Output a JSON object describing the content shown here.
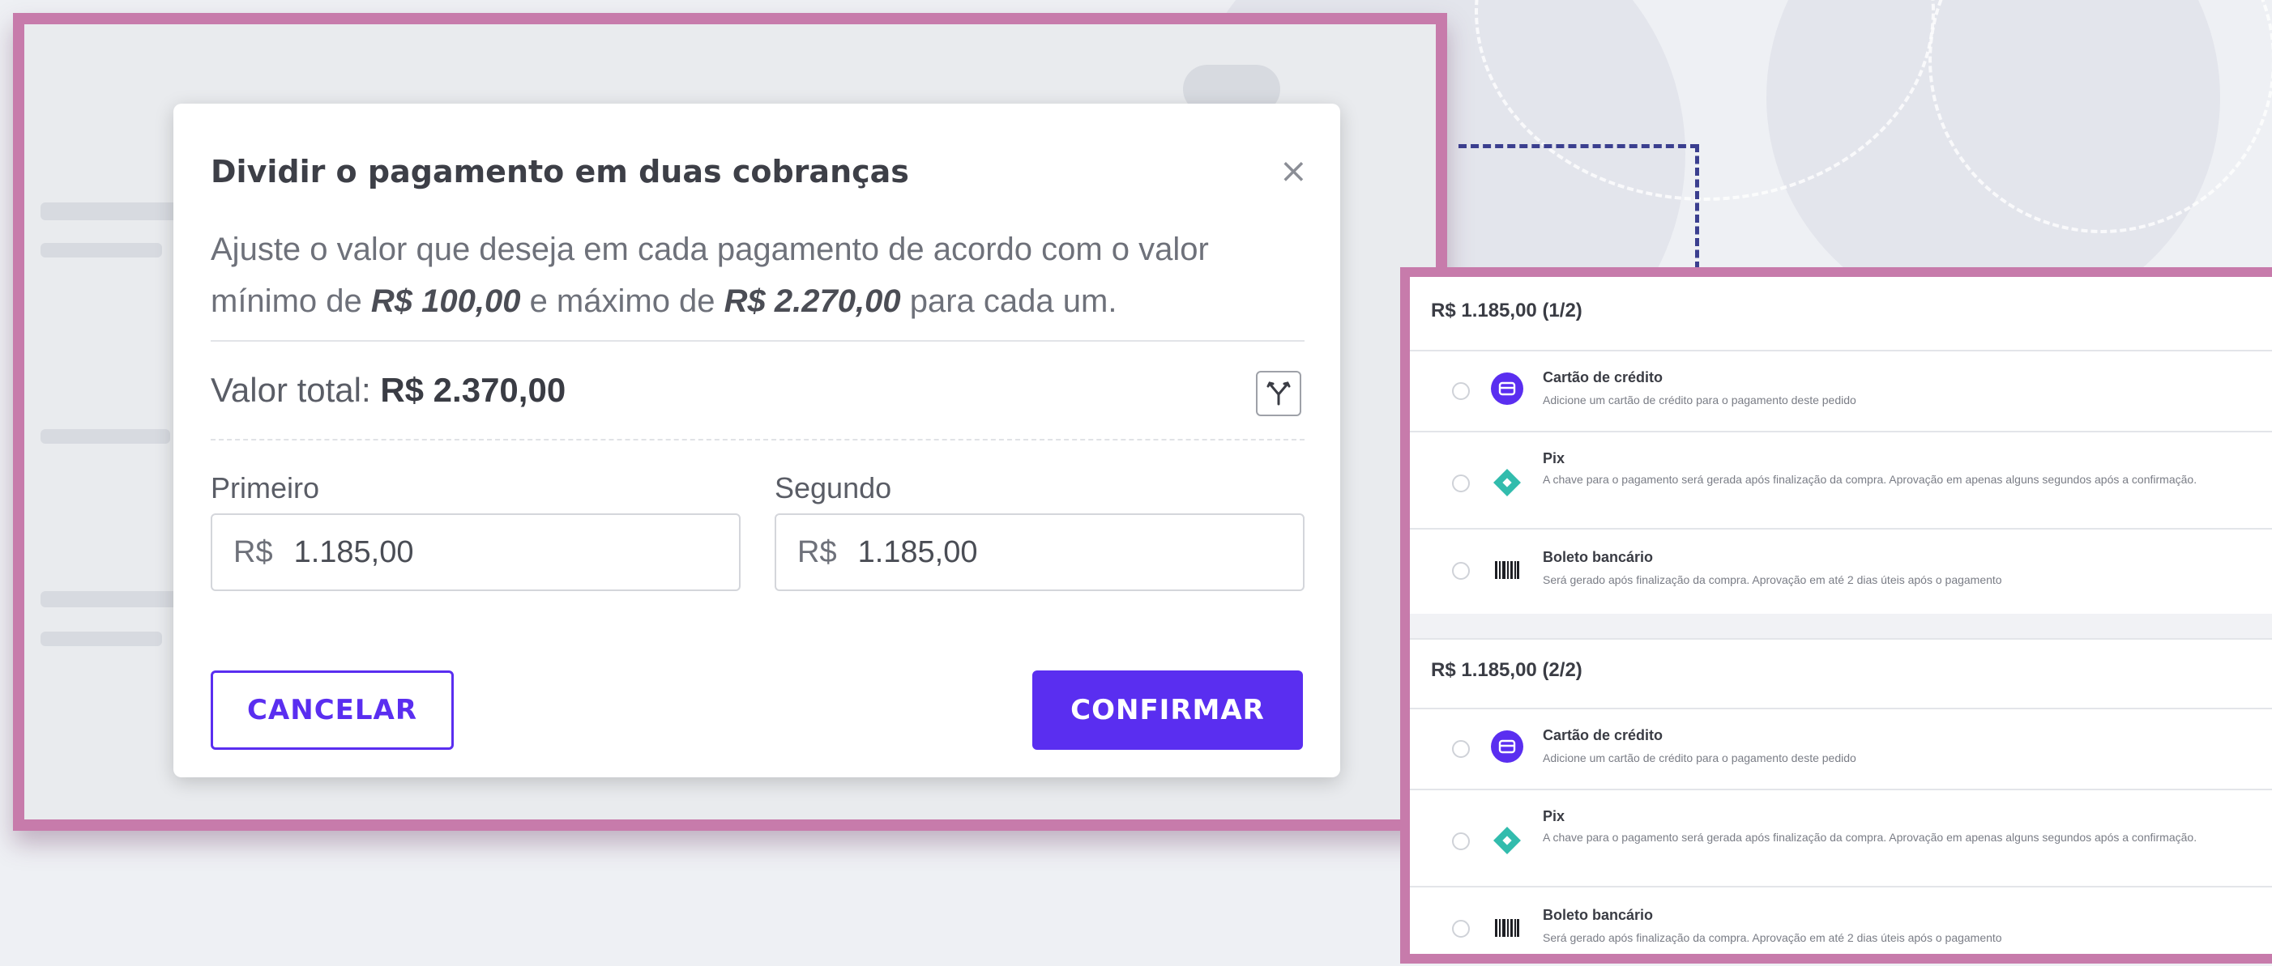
{
  "modal": {
    "title": "Dividir o pagamento em duas cobranças",
    "close_icon": "close-icon",
    "description_part1": "Ajuste o valor que deseja em cada pagamento de acordo com o valor mínimo de ",
    "min_value": "R$ 100,00",
    "description_part2": " e máximo de ",
    "max_value": "R$ 2.270,00",
    "description_part3": " para cada um.",
    "total_label": "Valor total: ",
    "total_value": "R$ 2.370,00",
    "split_icon": "split-icon",
    "first_label": "Primeiro",
    "second_label": "Segundo",
    "currency": "R$",
    "first_value": "1.185,00",
    "second_value": "1.185,00",
    "cancel_label": "CANCELAR",
    "confirm_label": "CONFIRMAR"
  },
  "colors": {
    "accent": "#5a2ef0",
    "frame": "#c77bab",
    "connector": "#3b3f8f",
    "pix": "#32bcad"
  },
  "payment_groups": [
    {
      "title": "R$ 1.185,00 (1/2)",
      "options": [
        {
          "icon": "credit-card-icon",
          "title": "Cartão de crédito",
          "description": "Adicione um cartão de crédito para o pagamento deste pedido"
        },
        {
          "icon": "pix-icon",
          "title": "Pix",
          "description": "A chave para o pagamento será gerada após finalização da compra. Aprovação em apenas alguns segundos após a confirmação."
        },
        {
          "icon": "barcode-icon",
          "title": "Boleto bancário",
          "description": "Será gerado após finalização da compra. Aprovação em até 2 dias úteis após o pagamento"
        }
      ]
    },
    {
      "title": "R$ 1.185,00 (2/2)",
      "options": [
        {
          "icon": "credit-card-icon",
          "title": "Cartão de crédito",
          "description": "Adicione um cartão de crédito para o pagamento deste pedido"
        },
        {
          "icon": "pix-icon",
          "title": "Pix",
          "description": "A chave para o pagamento será gerada após finalização da compra. Aprovação em apenas alguns segundos após a confirmação."
        },
        {
          "icon": "barcode-icon",
          "title": "Boleto bancário",
          "description": "Será gerado após finalização da compra. Aprovação em até 2 dias úteis após o pagamento"
        }
      ]
    }
  ]
}
